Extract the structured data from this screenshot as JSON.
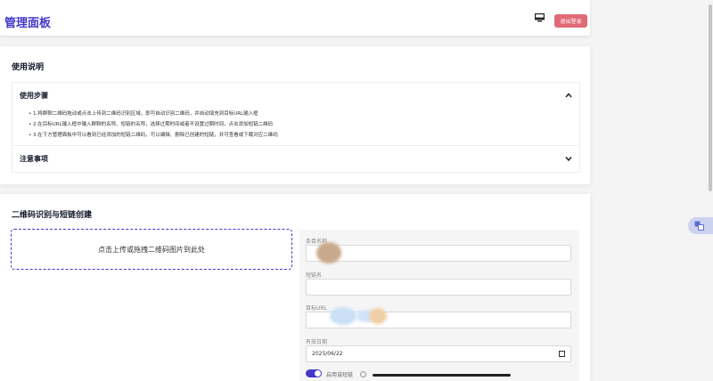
{
  "header": {
    "title": "管理面板",
    "logout_label": "退出登录",
    "monitor_icon": "monitor-icon"
  },
  "usage": {
    "title": "使用说明",
    "steps_header": "使用步骤",
    "steps": [
      "1.将群聊二维码拖动或点击上传到二维码识别区域，即可自动识别二维码，并自动填充到目标URL输入框",
      "2.在目标URL输入框中输入群聊的名称、短链的名称，选择过期时间或者不设置过期时间，点击添加短链二维码",
      "3.在下方管理面板中可以看到已经添加的短链二维码，可以编辑、删除已创建的短链，并可查看或下载对应二维码"
    ],
    "notes_header": "注意事项"
  },
  "create": {
    "title": "二维码识别与短链创建",
    "dropzone_text": "点击上传或拖拽二维码图片到此处",
    "fields": {
      "name_label": "条目名称",
      "name_value": "",
      "shortlink_label": "短链名",
      "shortlink_value": "",
      "target_label": "目标URL",
      "target_value": "",
      "expiry_label": "有效日期",
      "expiry_value": "2025/06/22"
    },
    "toggle_label": "启用该短链",
    "toggle_on": true
  },
  "colors": {
    "accent": "#4338ca",
    "logout": "#e06a76"
  }
}
